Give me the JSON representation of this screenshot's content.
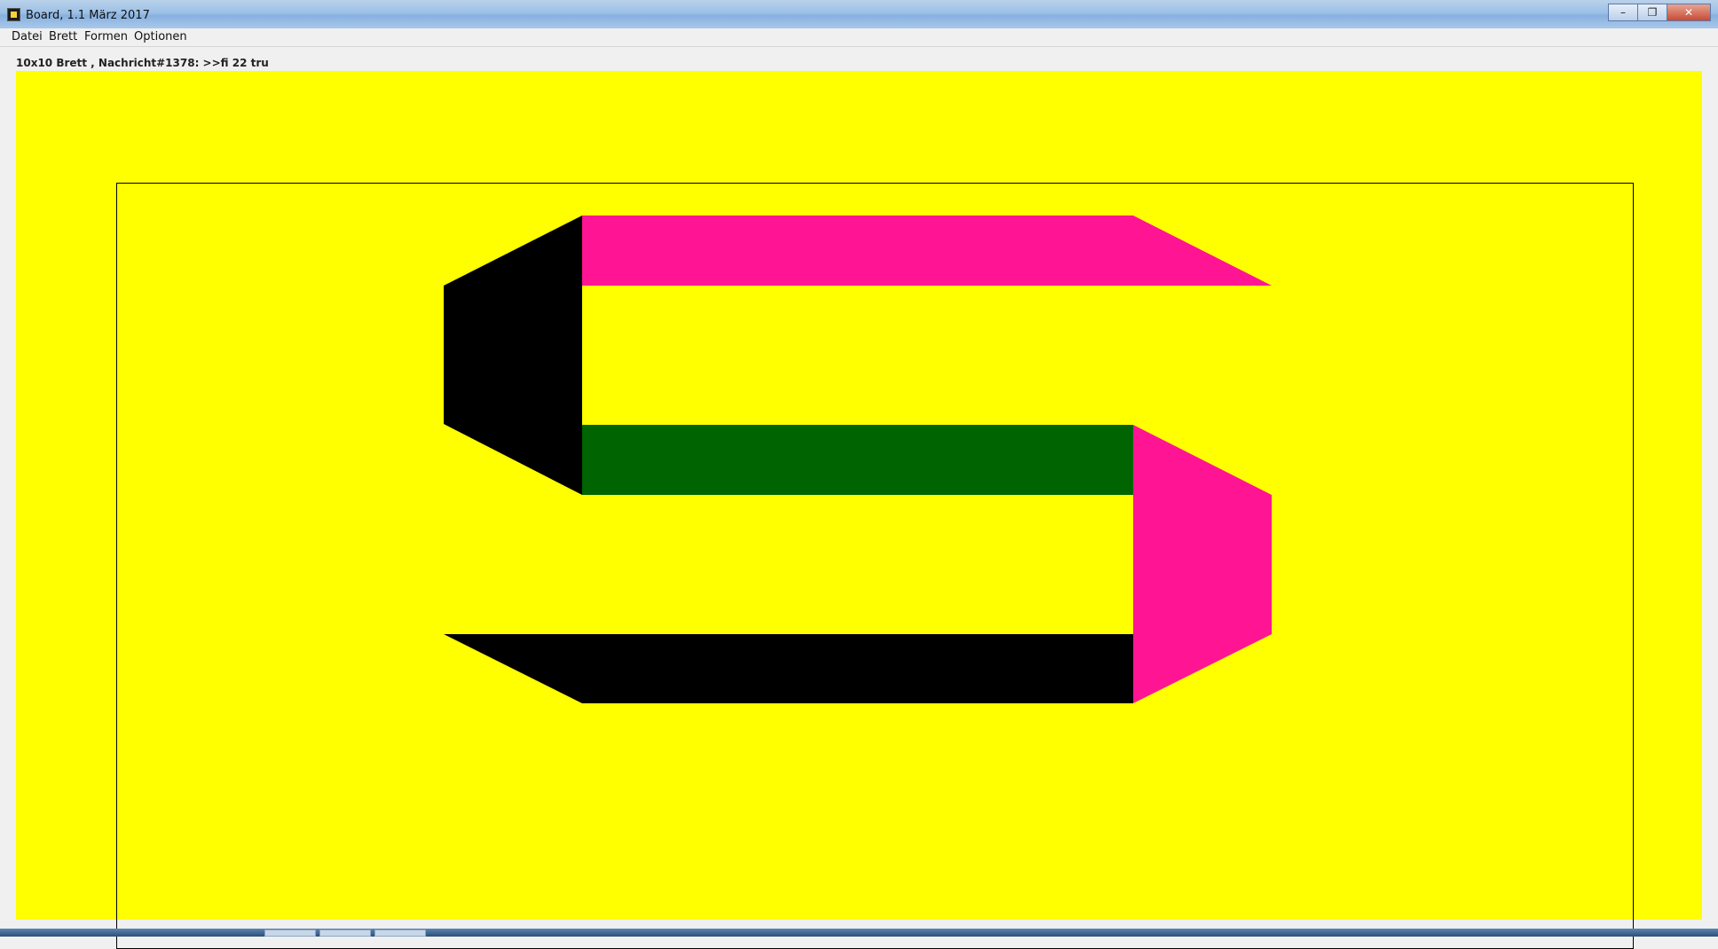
{
  "window": {
    "title": "Board, 1.1 März 2017",
    "minimize": "–",
    "maximize": "❐",
    "close": "✕"
  },
  "menu": [
    "Datei",
    "Brett",
    "Formen",
    "Optionen"
  ],
  "status": "10x10 Brett , Nachricht#1378: >>fi 22 tru",
  "board": {
    "background": "#ffff00",
    "shapes": [
      {
        "name": "top-bar",
        "color": "#ff1493"
      },
      {
        "name": "upper-left-side",
        "color": "#000000"
      },
      {
        "name": "middle-bar",
        "color": "#006400"
      },
      {
        "name": "lower-right-side",
        "color": "#ff1493"
      },
      {
        "name": "bottom-bar",
        "color": "#000000"
      }
    ]
  }
}
